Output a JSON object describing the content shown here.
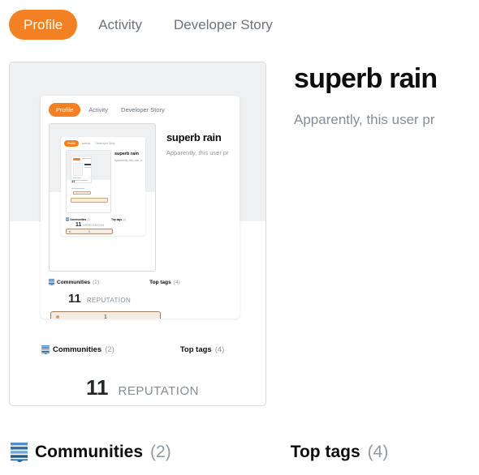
{
  "tabs": [
    {
      "label": "Profile",
      "active": true
    },
    {
      "label": "Activity",
      "active": false
    },
    {
      "label": "Developer Story",
      "active": false
    }
  ],
  "profile": {
    "title": "superb rain",
    "description": "Apparently, this user pr",
    "reputation": {
      "value": "11",
      "label": "REPUTATION"
    },
    "badges": {
      "bronze_count": "1"
    }
  },
  "stats_row": {
    "communities": {
      "label": "Communities",
      "count": "(2)",
      "icon": "stack-exchange-icon"
    },
    "top_tags": {
      "label": "Top tags",
      "count": "(4)"
    }
  },
  "colors": {
    "accent_orange": "#f48024",
    "card_gray": "#eff0f1",
    "card_border": "#d6dbdf",
    "bronze_bg": "#f5ece1",
    "bronze_border": "#9e7c5a",
    "bronze_dot": "#cd9b72",
    "muted_text": "#848d95",
    "dark_text": "#0c0d0e"
  }
}
